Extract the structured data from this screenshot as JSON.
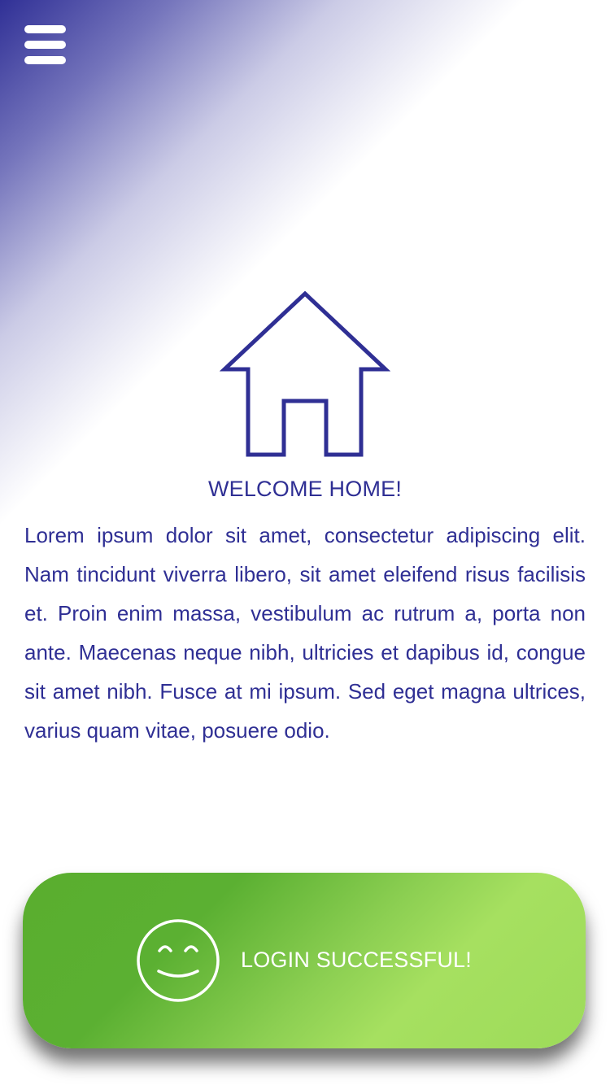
{
  "header": {
    "menu_icon": "hamburger-menu-icon"
  },
  "main": {
    "icon": "house-icon",
    "title": "WELCOME HOME!",
    "body": "Lorem ipsum dolor sit amet, consectetur adipiscing elit. Nam tincidunt viverra libero, sit amet eleifend risus facilisis et. Proin enim massa, vestibulum ac rutrum a, porta non ante. Maecenas neque nibh, ultricies et dapibus id, congue sit amet nibh. Fusce at mi ipsum. Sed eget magna ultrices, varius quam vitae, posuere odio."
  },
  "banner": {
    "icon": "smiley-face-icon",
    "label": "LOGIN SUCCESSFUL!"
  },
  "colors": {
    "accent": "#2f2f94",
    "success_start": "#5aae2e",
    "success_end": "#a6e060",
    "background": "#ffffff"
  }
}
